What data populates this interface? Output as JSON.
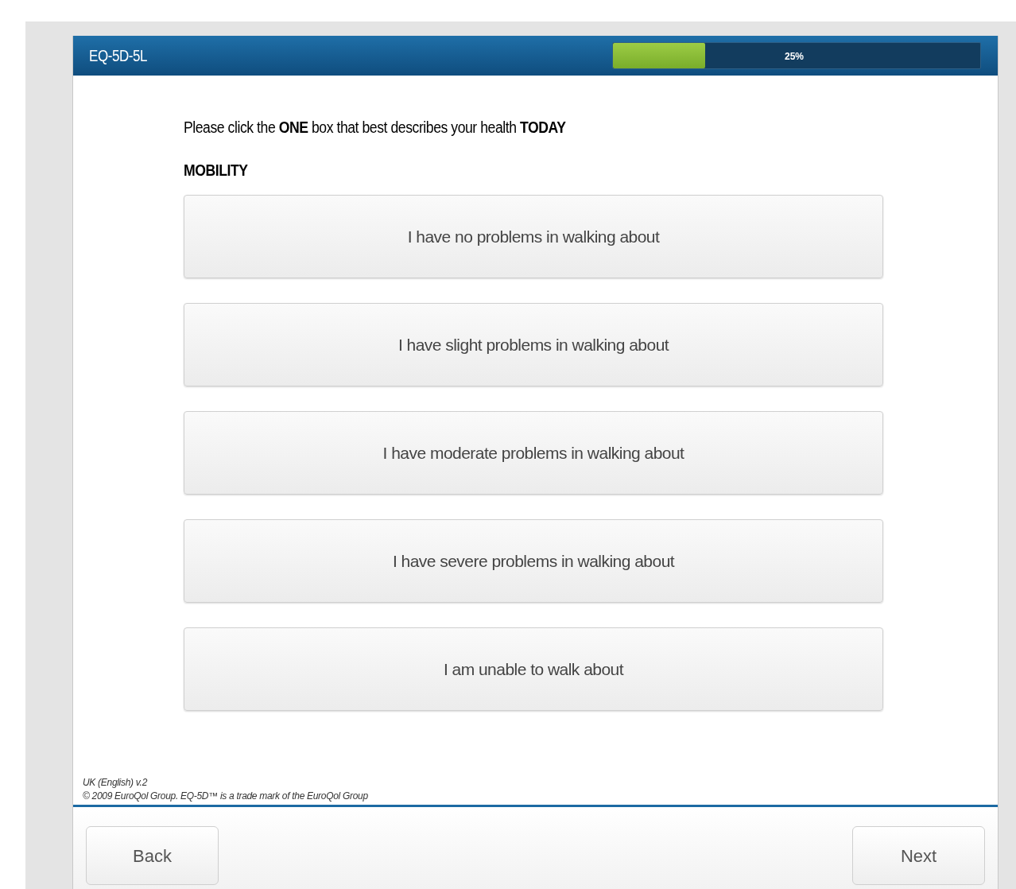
{
  "header": {
    "title": "EQ-5D-5L",
    "progress": {
      "level": 0.25,
      "reading": "25%"
    }
  },
  "instruction": "Please click the **ONE** box that best describes your health **TODAY**",
  "section": "MOBILITY",
  "options": [
    {
      "label": "I have no problems in walking about"
    },
    {
      "label": "I have slight problems in walking about"
    },
    {
      "label": "I have moderate problems in walking about"
    },
    {
      "label": "I have severe problems in walking about"
    },
    {
      "label": "I am unable to walk about"
    }
  ],
  "footer": {
    "version": "UK (English) v.2",
    "copyright": "© 2009 EuroQol Group. EQ-5D™ is a trade mark of the EuroQol Group"
  },
  "buttons": {
    "back": "Back",
    "next": "Next"
  }
}
